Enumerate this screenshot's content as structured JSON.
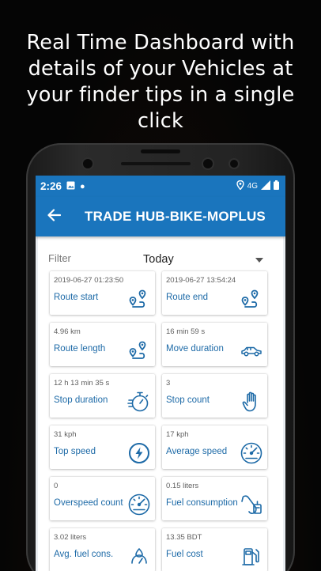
{
  "promo": {
    "headline": "Real Time Dashboard with details of your Vehicles at your finder tips in a single click"
  },
  "statusbar": {
    "time": "2:26",
    "network": "4G"
  },
  "appbar": {
    "title": "TRADE HUB-BIKE-MOPLUS",
    "back_icon": "arrow-left-icon"
  },
  "filter": {
    "label": "Filter",
    "selected": "Today"
  },
  "cards": [
    {
      "value": "2019-06-27 01:23:50",
      "label": "Route start",
      "icon": "route-icon"
    },
    {
      "value": "2019-06-27 13:54:24",
      "label": "Route end",
      "icon": "route-icon"
    },
    {
      "value": "4.96 km",
      "label": "Route length",
      "icon": "route-icon"
    },
    {
      "value": "16 min 59 s",
      "label": "Move duration",
      "icon": "car-icon"
    },
    {
      "value": "12 h 13 min 35 s",
      "label": "Stop duration",
      "icon": "stopwatch-icon"
    },
    {
      "value": "3",
      "label": "Stop count",
      "icon": "hand-icon"
    },
    {
      "value": "31 kph",
      "label": "Top speed",
      "icon": "lightning-icon"
    },
    {
      "value": "17 kph",
      "label": "Average speed",
      "icon": "speedometer-icon"
    },
    {
      "value": "0",
      "label": "Overspeed count",
      "icon": "speedometer-icon"
    },
    {
      "value": "0.15 liters",
      "label": "Fuel consumption",
      "icon": "fuel-pump-icon"
    },
    {
      "value": "3.02 liters",
      "label": "Avg. fuel cons.",
      "icon": "fuel-icon"
    },
    {
      "value": "13.35 BDT",
      "label": "Fuel cost",
      "icon": "fuel-cost-icon"
    }
  ],
  "colors": {
    "primary": "#1a75bd",
    "label": "#1d6aa7",
    "background": "#e9edf1"
  }
}
